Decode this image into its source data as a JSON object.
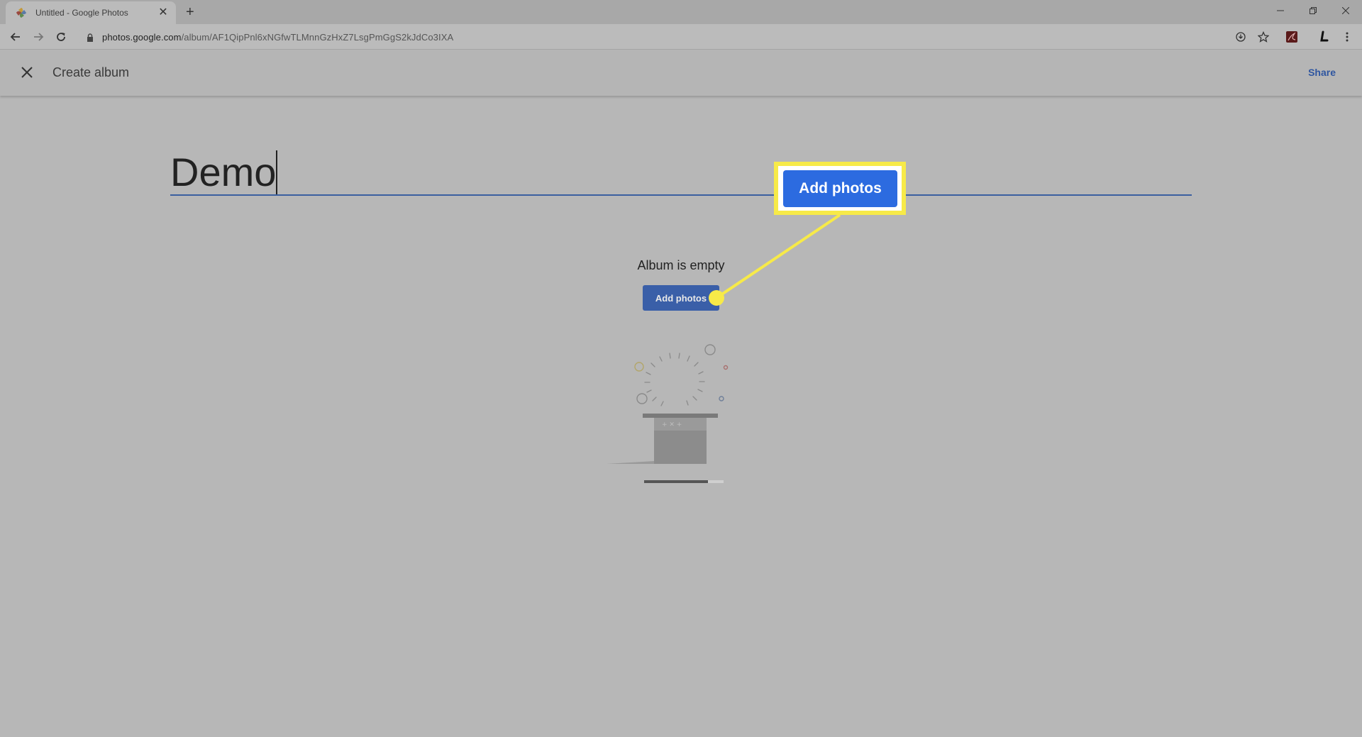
{
  "browser": {
    "tab_title": "Untitled - Google Photos",
    "url_host": "photos.google.com",
    "url_path": "/album/AF1QipPnl6xNGfwTLMnnGzHxZ7LsgPmGgS2kJdCo3IXA"
  },
  "header": {
    "title": "Create album",
    "share_label": "Share"
  },
  "album": {
    "title_value": "Demo",
    "empty_message": "Album is empty",
    "add_photos_label": "Add photos"
  },
  "callout": {
    "label": "Add photos",
    "highlight_color": "#f7ea48",
    "button_color": "#2c6be0"
  },
  "colors": {
    "overlay_background": "#b7b7b7",
    "accent_blue": "#3a5fa8"
  }
}
